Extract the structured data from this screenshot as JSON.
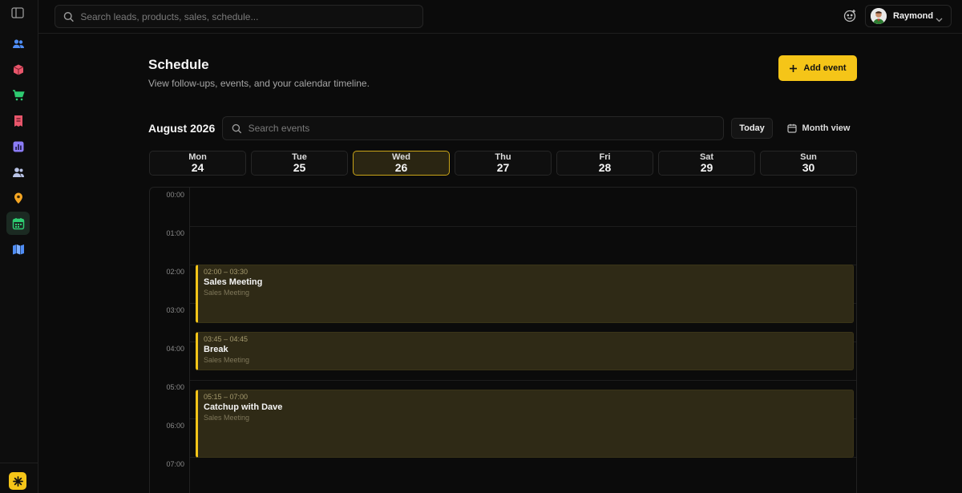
{
  "topbar": {
    "search_placeholder": "Search leads, products, sales, schedule...",
    "user_name": "Raymond"
  },
  "sidebar": {
    "items": [
      {
        "name": "leads",
        "icon": "users-icon",
        "color": "#4f8df5",
        "active": false
      },
      {
        "name": "products",
        "icon": "box-icon",
        "color": "#e8566b",
        "active": false
      },
      {
        "name": "sales",
        "icon": "cart-icon",
        "color": "#2ecc71",
        "active": false
      },
      {
        "name": "invoices",
        "icon": "receipt-icon",
        "color": "#e8566b",
        "active": false
      },
      {
        "name": "reports",
        "icon": "chart-icon",
        "color": "#8b7cf6",
        "active": false
      },
      {
        "name": "contacts",
        "icon": "contacts-icon",
        "color": "#b9c3e6",
        "active": false
      },
      {
        "name": "locations",
        "icon": "pin-icon",
        "color": "#f5a623",
        "active": false
      },
      {
        "name": "schedule",
        "icon": "calendar-icon",
        "color": "#2ecc71",
        "active": true
      },
      {
        "name": "map",
        "icon": "map-icon",
        "color": "#4f8df5",
        "active": false
      }
    ]
  },
  "page": {
    "title": "Schedule",
    "subtitle": "View follow-ups, events, and your calendar timeline.",
    "add_event_label": "Add event"
  },
  "calendar": {
    "month_label": "August 2026",
    "search_placeholder": "Search events",
    "today_label": "Today",
    "view_label": "Month view",
    "days": [
      {
        "name": "Mon",
        "num": "24",
        "active": false
      },
      {
        "name": "Tue",
        "num": "25",
        "active": false
      },
      {
        "name": "Wed",
        "num": "26",
        "active": true
      },
      {
        "name": "Thu",
        "num": "27",
        "active": false
      },
      {
        "name": "Fri",
        "num": "28",
        "active": false
      },
      {
        "name": "Sat",
        "num": "29",
        "active": false
      },
      {
        "name": "Sun",
        "num": "30",
        "active": false
      }
    ],
    "hours": [
      "00:00",
      "01:00",
      "02:00",
      "03:00",
      "04:00",
      "05:00",
      "06:00",
      "07:00"
    ],
    "events": [
      {
        "time": "02:00 – 03:30",
        "title": "Sales Meeting",
        "desc": "Sales Meeting"
      },
      {
        "time": "03:45 – 04:45",
        "title": "Break",
        "desc": "Sales Meeting"
      },
      {
        "time": "05:15 – 07:00",
        "title": "Catchup with Dave",
        "desc": "Sales Meeting"
      }
    ]
  },
  "colors": {
    "accent": "#f5c518",
    "background": "#0b0b0b"
  }
}
